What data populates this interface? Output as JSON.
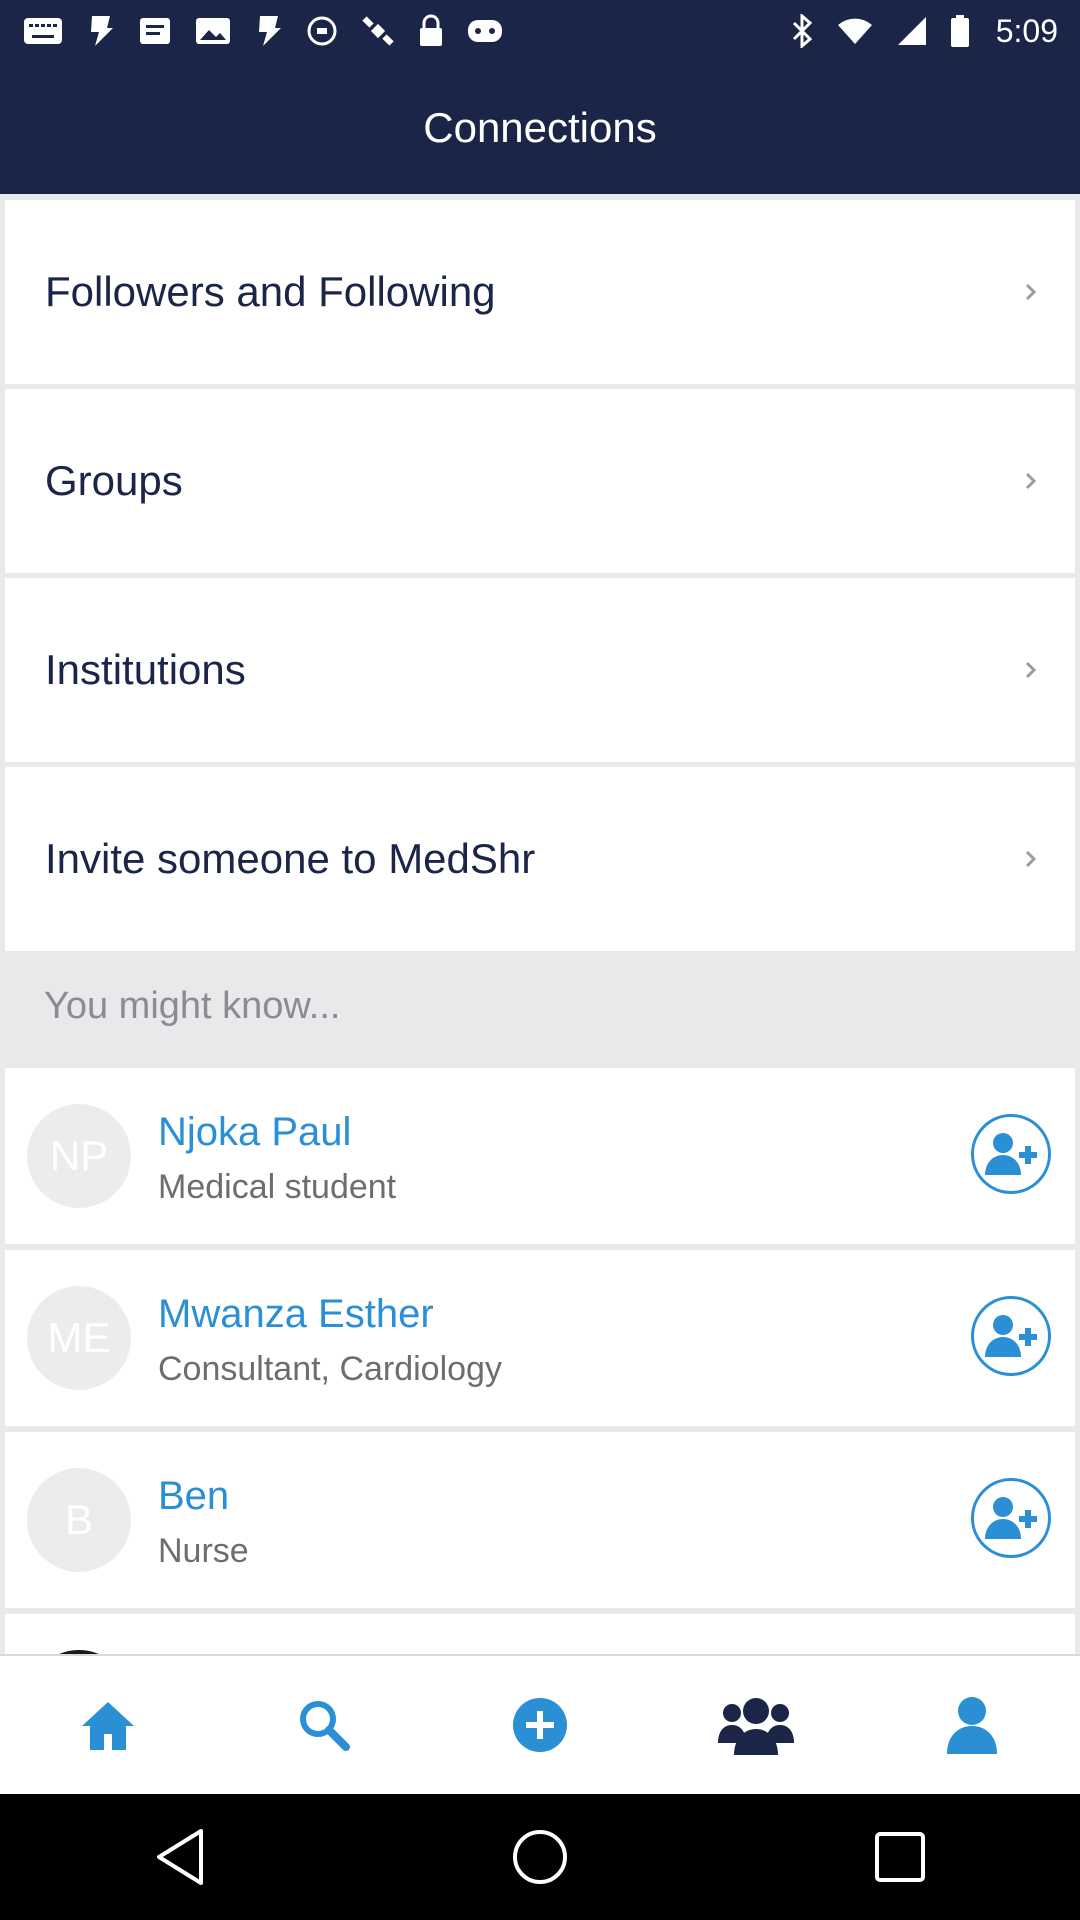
{
  "status_bar": {
    "time": "5:09",
    "left_icons": [
      "messages-icon",
      "app-icon",
      "notification-icon",
      "gallery-icon",
      "app-icon",
      "circle-icon",
      "satellite-icon",
      "lock-icon",
      "gamepad-icon"
    ],
    "right_icons": [
      "bluetooth-icon",
      "wifi-icon",
      "signal-icon",
      "battery-icon"
    ]
  },
  "header": {
    "title": "Connections"
  },
  "menu": [
    {
      "label": "Followers and Following"
    },
    {
      "label": "Groups"
    },
    {
      "label": "Institutions"
    },
    {
      "label": "Invite someone to MedShr"
    }
  ],
  "suggestions": {
    "title": "You might know...",
    "people": [
      {
        "initials": "NP",
        "name": "Njoka Paul",
        "role": "Medical student"
      },
      {
        "initials": "ME",
        "name": "Mwanza Esther",
        "role": "Consultant, Cardiology"
      },
      {
        "initials": "B",
        "name": "Ben",
        "role": "Nurse"
      }
    ]
  },
  "bottom_nav": {
    "items": [
      "home-icon",
      "search-icon",
      "add-icon",
      "connections-icon",
      "profile-icon"
    ],
    "active": "connections-icon"
  },
  "colors": {
    "header_bg": "#1a2547",
    "accent": "#2a8fd4",
    "background": "#e8e9eb"
  }
}
